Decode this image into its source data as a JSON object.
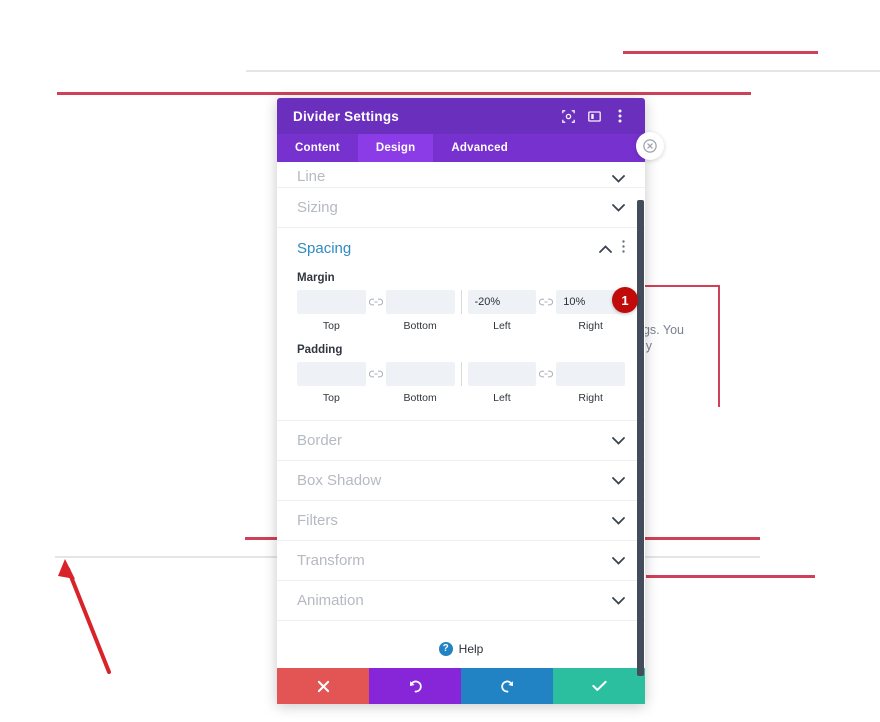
{
  "modal": {
    "title": "Divider Settings",
    "header_icons": [
      "target-icon",
      "layout-icon",
      "kebab-icon"
    ],
    "tabs": [
      {
        "label": "Content",
        "active": false
      },
      {
        "label": "Design",
        "active": true
      },
      {
        "label": "Advanced",
        "active": false
      }
    ],
    "sections": [
      {
        "label": "Line",
        "state": "collapsed"
      },
      {
        "label": "Sizing",
        "state": "collapsed"
      },
      {
        "label": "Spacing",
        "state": "expanded"
      },
      {
        "label": "Border",
        "state": "collapsed"
      },
      {
        "label": "Box Shadow",
        "state": "collapsed"
      },
      {
        "label": "Filters",
        "state": "collapsed"
      },
      {
        "label": "Transform",
        "state": "collapsed"
      },
      {
        "label": "Animation",
        "state": "collapsed"
      }
    ],
    "spacing": {
      "title": "Spacing",
      "margin": {
        "label": "Margin",
        "fields": [
          {
            "caption": "Top",
            "value": "",
            "placeholder": ""
          },
          {
            "caption": "Bottom",
            "value": "",
            "placeholder": ""
          },
          {
            "caption": "Left",
            "value": "-20%",
            "placeholder": ""
          },
          {
            "caption": "Right",
            "value": "10%",
            "placeholder": ""
          }
        ]
      },
      "padding": {
        "label": "Padding",
        "fields": [
          {
            "caption": "Top",
            "value": "",
            "placeholder": ""
          },
          {
            "caption": "Bottom",
            "value": "",
            "placeholder": ""
          },
          {
            "caption": "Left",
            "value": "",
            "placeholder": ""
          },
          {
            "caption": "Right",
            "value": "",
            "placeholder": ""
          }
        ]
      }
    },
    "help": {
      "label": "Help",
      "badge": "?"
    },
    "footer_buttons": [
      {
        "name": "close",
        "glyph": "✖"
      },
      {
        "name": "undo",
        "glyph": "↺"
      },
      {
        "name": "redo",
        "glyph": "↻"
      },
      {
        "name": "save",
        "glyph": "✔"
      }
    ]
  },
  "annotations": {
    "step_badge": "1"
  },
  "background": {
    "text_fragment_1": "ngs. You",
    "text_fragment_2": "ply"
  },
  "colors": {
    "modal_header": "#6a2fbd",
    "tabs_bar": "#7731cf",
    "tab_active": "#8b3ce6",
    "section_open_title": "#2e8bc4",
    "annotation_red": "#cf4158",
    "badge_red": "#c10b0b",
    "btn_close": "#e35454",
    "btn_undo": "#8726d9",
    "btn_redo": "#2183c4",
    "btn_save": "#2bbfa0"
  }
}
